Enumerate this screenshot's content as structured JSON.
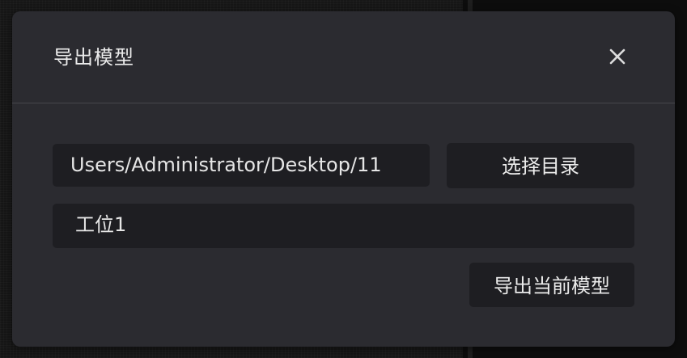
{
  "dialog": {
    "title": "导出模型",
    "close_icon": "close-icon",
    "path_value": "Users/Administrator/Desktop/11",
    "select_dir_label": "选择目录",
    "model_name_value": "工位1",
    "export_label": "导出当前模型"
  },
  "colors": {
    "dialog_bg": "#2b2b30",
    "field_bg": "#1e1e22",
    "text": "#ececec",
    "divider": "#46464c"
  }
}
